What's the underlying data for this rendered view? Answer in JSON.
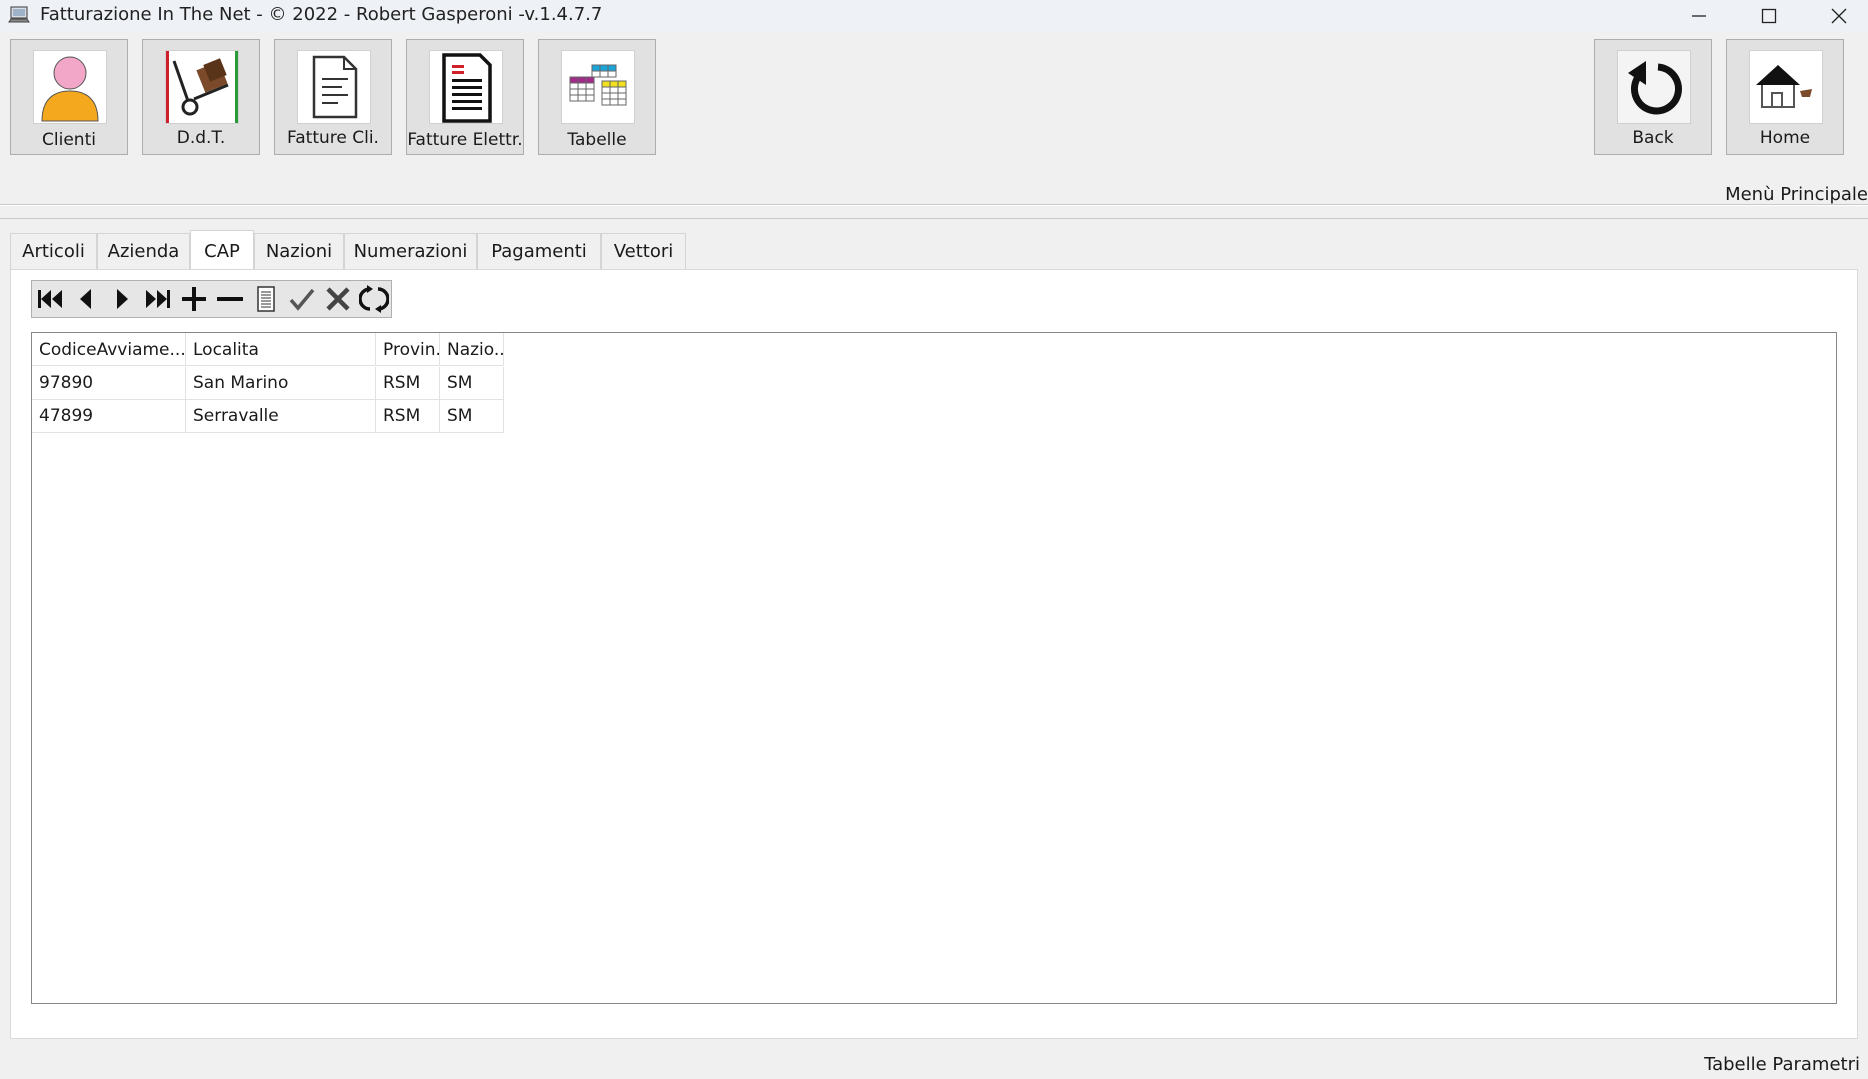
{
  "window": {
    "title": "Fatturazione In The Net - © 2022 - Robert Gasperoni -v.1.4.7.7"
  },
  "ribbon": {
    "buttons": [
      {
        "label": "Clienti",
        "icon": "user-icon"
      },
      {
        "label": "D.d.T.",
        "icon": "hand-truck-icon"
      },
      {
        "label": "Fatture Cli.",
        "icon": "document-icon"
      },
      {
        "label": "Fatture Elettr.",
        "icon": "electronic-invoice-icon"
      },
      {
        "label": "Tabelle",
        "icon": "tables-icon"
      }
    ],
    "back_label": "Back",
    "home_label": "Home",
    "menu_label": "Menù Principale"
  },
  "tabs": [
    {
      "label": "Articoli",
      "active": false
    },
    {
      "label": "Azienda",
      "active": false
    },
    {
      "label": "CAP",
      "active": true
    },
    {
      "label": "Nazioni",
      "active": false
    },
    {
      "label": "Numerazioni",
      "active": false
    },
    {
      "label": "Pagamenti",
      "active": false
    },
    {
      "label": "Vettori",
      "active": false
    }
  ],
  "navigator": [
    "first-record-icon",
    "prior-record-icon",
    "next-record-icon",
    "last-record-icon",
    "insert-icon",
    "delete-icon",
    "edit-icon",
    "post-icon",
    "cancel-icon",
    "refresh-icon"
  ],
  "grid": {
    "columns": [
      "CodiceAvviame...",
      "Localita",
      "Provin...",
      "Nazio..."
    ],
    "rows": [
      [
        "97890",
        "San Marino",
        "RSM",
        "SM"
      ],
      [
        "47899",
        "Serravalle",
        "RSM",
        "SM"
      ]
    ]
  },
  "status": {
    "label": "Tabelle Parametri"
  }
}
